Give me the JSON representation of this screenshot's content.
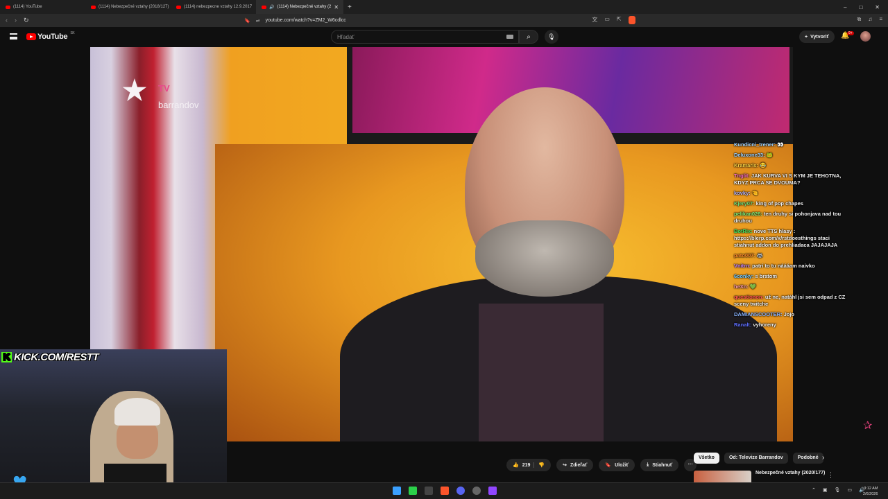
{
  "browser": {
    "tabs": [
      {
        "label": "(1114) YouTube",
        "active": false
      },
      {
        "label": "(1114) Nebezpečné vztahy (2018/127)",
        "active": false
      },
      {
        "label": "(1114) nebezpecne vztahy 12.9.2017",
        "active": false
      },
      {
        "label": "(1114) Nebezpečné vztahy (2",
        "active": true
      }
    ],
    "url": "youtube.com/watch?v=ZM2_W6cdlcc",
    "new_tab": "+",
    "window_controls": [
      "–",
      "□",
      "✕"
    ]
  },
  "youtube": {
    "logo_text": "YouTube",
    "region": "SK",
    "search_placeholder": "Hľadať",
    "create_label": "Vytvoriť",
    "notification_count": "9+"
  },
  "video": {
    "channel_logo_brand": "barrandov",
    "channel_logo_tv": "TV"
  },
  "webcam": {
    "kick_url": "KICK.COM/RESTT",
    "kick_badge": "K"
  },
  "chat": [
    {
      "user": "Kundicni_trener:",
      "text": "👀",
      "color": "#9ad0ff"
    },
    {
      "user": "Deluxone33:",
      "text": "🐸",
      "color": "#9ad0ff"
    },
    {
      "user": "Kramaris:",
      "text": "😂",
      "color": "#f6d046"
    },
    {
      "user": "Tnglit:",
      "text": "JAK KURVA VI S KYM JE TEHOTNA, KDYZ PRCA SE DVOUMA?",
      "color": "#ff6ec7"
    },
    {
      "user": "kovky:",
      "text": "🤏",
      "color": "#b4b4ff"
    },
    {
      "user": "Kjery07:",
      "text": "king of pop chapes",
      "color": "#6ee07a"
    },
    {
      "user": "pelikan026:",
      "text": "ten druhy si pohonjava nad tou druhou",
      "color": "#7af07a"
    },
    {
      "user": "BotRix:",
      "text": "nove TTS hlasy : https://blerp.com/x/rstdoesthings staci stiahnut addon do prehliadaca JAJAJAJA",
      "color": "#40e060"
    },
    {
      "user": "pato007:",
      "text": "🦝",
      "color": "#ff8a2a"
    },
    {
      "user": "Vnitrn:",
      "text": "patri to tu náááam naivko",
      "color": "#c080ff"
    },
    {
      "user": "6conky:",
      "text": "s bratom",
      "color": "#70c8ff"
    },
    {
      "user": "heXn:",
      "text": "💚",
      "color": "#ff9ab0"
    },
    {
      "user": "questionon:",
      "text": "už ne, natáhl jsi sem odpad z CZ sceny twitche",
      "color": "#ff5050"
    },
    {
      "user": "DAMIANSCOOTER:",
      "text": "Jojo",
      "color": "#8ab4ff"
    },
    {
      "user": "Ranalt:",
      "text": "vyhoreny",
      "color": "#6070ff"
    }
  ],
  "actions": {
    "like_count": "219",
    "share_label": "Zdieľať",
    "save_label": "Uložiť",
    "download_label": "Stiahnuť",
    "more_label": "···"
  },
  "chips": [
    {
      "label": "Všetko",
      "selected": true
    },
    {
      "label": "Od: Televize Barrandov",
      "selected": false
    },
    {
      "label": "Podobné",
      "selected": false
    }
  ],
  "suggestion": {
    "title": "Nebezpečné vztahy (2020/177)",
    "menu": "⋮"
  },
  "taskbar": {
    "time": "3:12 AM",
    "date": "2/6/2026"
  }
}
